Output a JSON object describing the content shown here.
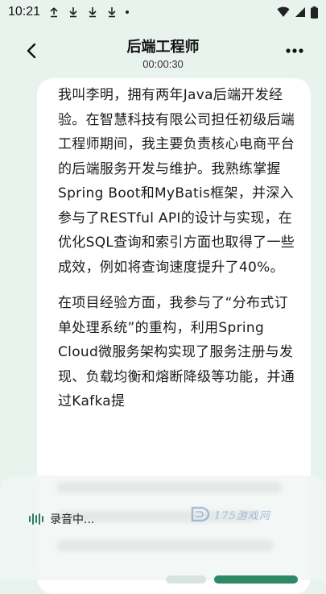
{
  "status_bar": {
    "time": "10:21",
    "notification_icons": [
      "upload-icon",
      "download-icon",
      "download-icon",
      "download-icon"
    ]
  },
  "header": {
    "title": "后端工程师",
    "timer": "00:00:30"
  },
  "transcript": {
    "paragraphs": [
      "我叫李明，拥有两年Java后端开发经验。在智慧科技有限公司担任初级后端工程师期间，我主要负责核心电商平台的后端服务开发与维护。我熟练掌握Spring Boot和MyBatis框架，并深入参与了RESTful API的设计与实现，在优化SQL查询和索引方面也取得了一些成效，例如将查询速度提升了40%。",
      "在项目经验方面，我参与了“分布式订单处理系统”的重构，利用Spring Cloud微服务架构实现了服务注册与发现、负载均衡和熔断降级等功能，并通过Kafka提"
    ]
  },
  "recording": {
    "status_label": "录音中...",
    "accent_color": "#2e8a66"
  },
  "watermark": {
    "text": "175游戏网"
  }
}
